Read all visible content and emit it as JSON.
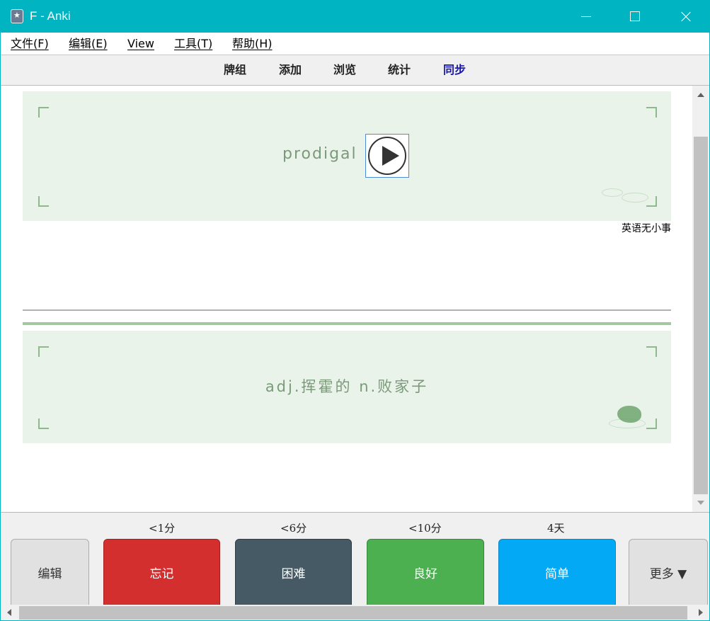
{
  "window": {
    "title": "F - Anki"
  },
  "menu": [
    {
      "label": "文件(F)"
    },
    {
      "label": "编辑(E)"
    },
    {
      "label": "View"
    },
    {
      "label": "工具(T)"
    },
    {
      "label": "帮助(H)"
    }
  ],
  "toolbar": {
    "decks": "牌组",
    "add": "添加",
    "browse": "浏览",
    "stats": "统计",
    "sync": "同步",
    "sync_color": "#1a17a8"
  },
  "card": {
    "front_word": "prodigal",
    "source": "英语无小事",
    "back_meaning": "adj.挥霍的 n.败家子"
  },
  "answer_buttons": {
    "edit": "编辑",
    "more": "更多 ▼",
    "again": {
      "label": "忘记",
      "interval": "<1分",
      "color": "#d32f2f"
    },
    "hard": {
      "label": "困难",
      "interval": "<6分",
      "color": "#455a64"
    },
    "good": {
      "label": "良好",
      "interval": "<10分",
      "color": "#4caf50"
    },
    "easy": {
      "label": "简单",
      "interval": "4天",
      "color": "#03a9f4"
    }
  }
}
